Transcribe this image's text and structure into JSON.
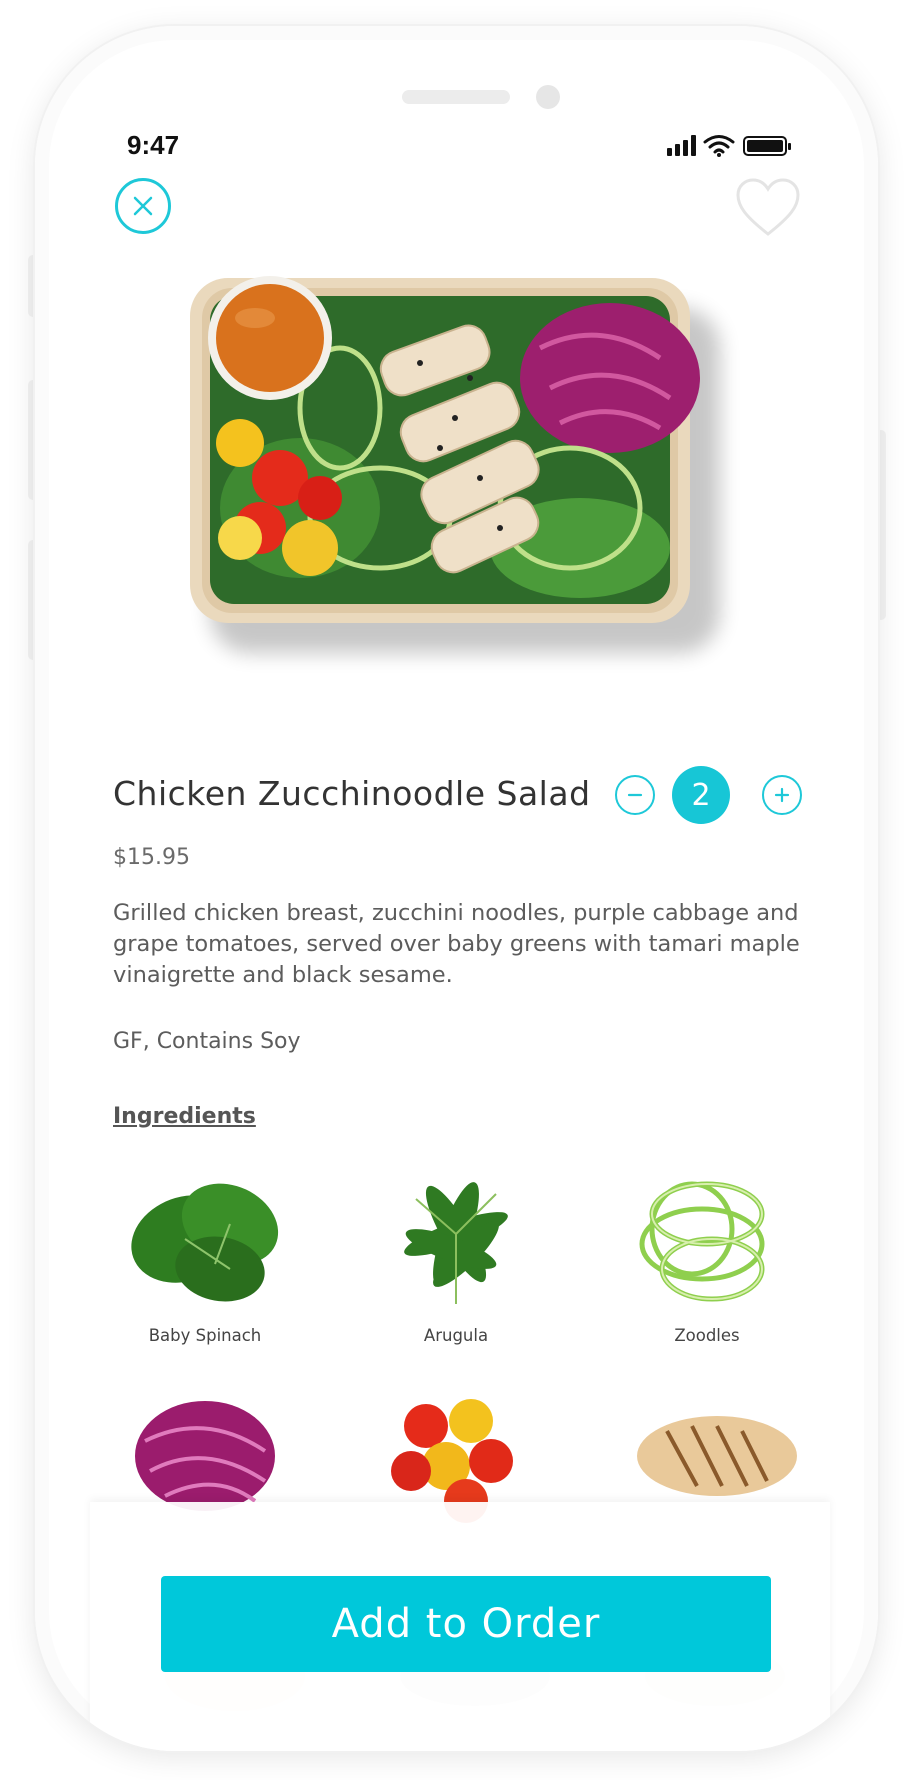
{
  "status_bar": {
    "time": "9:47"
  },
  "product": {
    "title": "Chicken Zucchinoodle Salad",
    "price": "$15.95",
    "description": "Grilled chicken breast, zucchini noodles, purple cabbage and grape tomatoes, served over baby greens with tamari maple vinaigrette and black sesame.",
    "tags": "GF, Contains Soy"
  },
  "quantity": {
    "value": "2"
  },
  "ingredients": {
    "heading": "Ingredients",
    "items": [
      {
        "label": "Baby Spinach"
      },
      {
        "label": "Arugula"
      },
      {
        "label": "Zoodles"
      }
    ]
  },
  "actions": {
    "add_to_order": "Add to Order"
  },
  "colors": {
    "accent": "#17c6d6",
    "button": "#00c8da"
  },
  "icons": {
    "close": "close-icon",
    "favorite": "heart-icon",
    "minus": "minus-icon",
    "plus": "plus-icon"
  }
}
